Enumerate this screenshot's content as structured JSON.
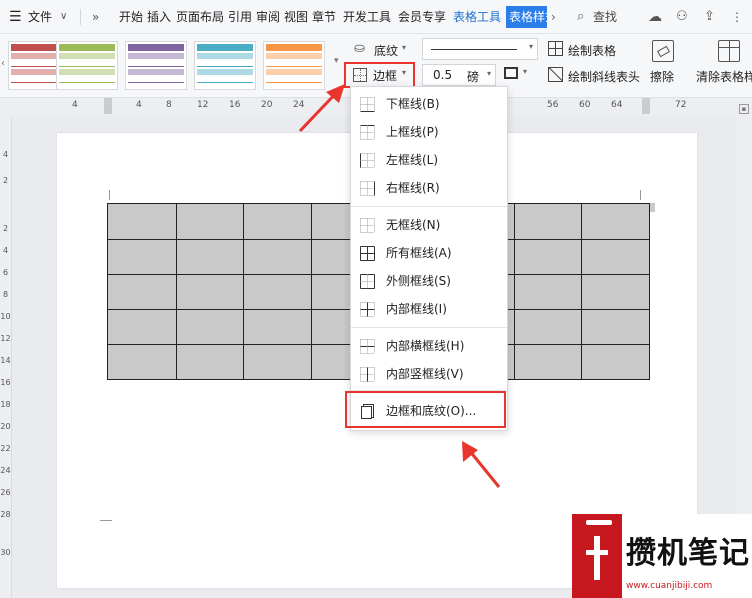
{
  "menubar": {
    "menu_label": "文件",
    "tabs": [
      "开始",
      "插入",
      "页面布局",
      "引用",
      "审阅",
      "视图",
      "章节",
      "开发工具",
      "会员专享",
      "表格工具",
      "表格样式"
    ],
    "search_label": "查找"
  },
  "ribbon": {
    "shading_label": "底纹",
    "border_label": "边框",
    "line_width": "0.5",
    "line_unit": "磅",
    "draw_table_label": "绘制表格",
    "draw_diagonal_label": "绘制斜线表头",
    "erase_label": "擦除",
    "clear_style_label": "清除表格样式",
    "style_colors": [
      "#c0504d",
      "#9bbb59",
      "#8064a2",
      "#4bacc6",
      "#f79646"
    ]
  },
  "ruler": {
    "ticks": [
      "4",
      "4",
      "8",
      "12",
      "16",
      "20",
      "24",
      "56",
      "60",
      "64",
      "72"
    ],
    "vticks": [
      "4",
      "2",
      "2",
      "4",
      "6",
      "8",
      "10",
      "12",
      "14",
      "16",
      "18",
      "20",
      "22",
      "24",
      "26",
      "28",
      "30"
    ]
  },
  "dropdown": {
    "items": [
      {
        "label": "下框线(B)",
        "icon": "bottom-border-icon"
      },
      {
        "label": "上框线(P)",
        "icon": "top-border-icon"
      },
      {
        "label": "左框线(L)",
        "icon": "left-border-icon"
      },
      {
        "label": "右框线(R)",
        "icon": "right-border-icon"
      },
      {
        "label": "无框线(N)",
        "icon": "no-border-icon"
      },
      {
        "label": "所有框线(A)",
        "icon": "all-borders-icon"
      },
      {
        "label": "外侧框线(S)",
        "icon": "outside-borders-icon"
      },
      {
        "label": "内部框线(I)",
        "icon": "inside-borders-icon"
      },
      {
        "label": "内部横框线(H)",
        "icon": "inside-horizontal-border-icon"
      },
      {
        "label": "内部竖框线(V)",
        "icon": "inside-vertical-border-icon"
      },
      {
        "label": "边框和底纹(O)...",
        "icon": "borders-and-shading-icon"
      }
    ]
  },
  "table": {
    "rows": 5,
    "cols": 8,
    "fill": "#c9c9c9"
  },
  "annotation": {
    "color": "#e8352d"
  },
  "watermark": {
    "text": "攒机笔记",
    "url": "www.cuanjibiji.com",
    "color": "#c8181f"
  }
}
